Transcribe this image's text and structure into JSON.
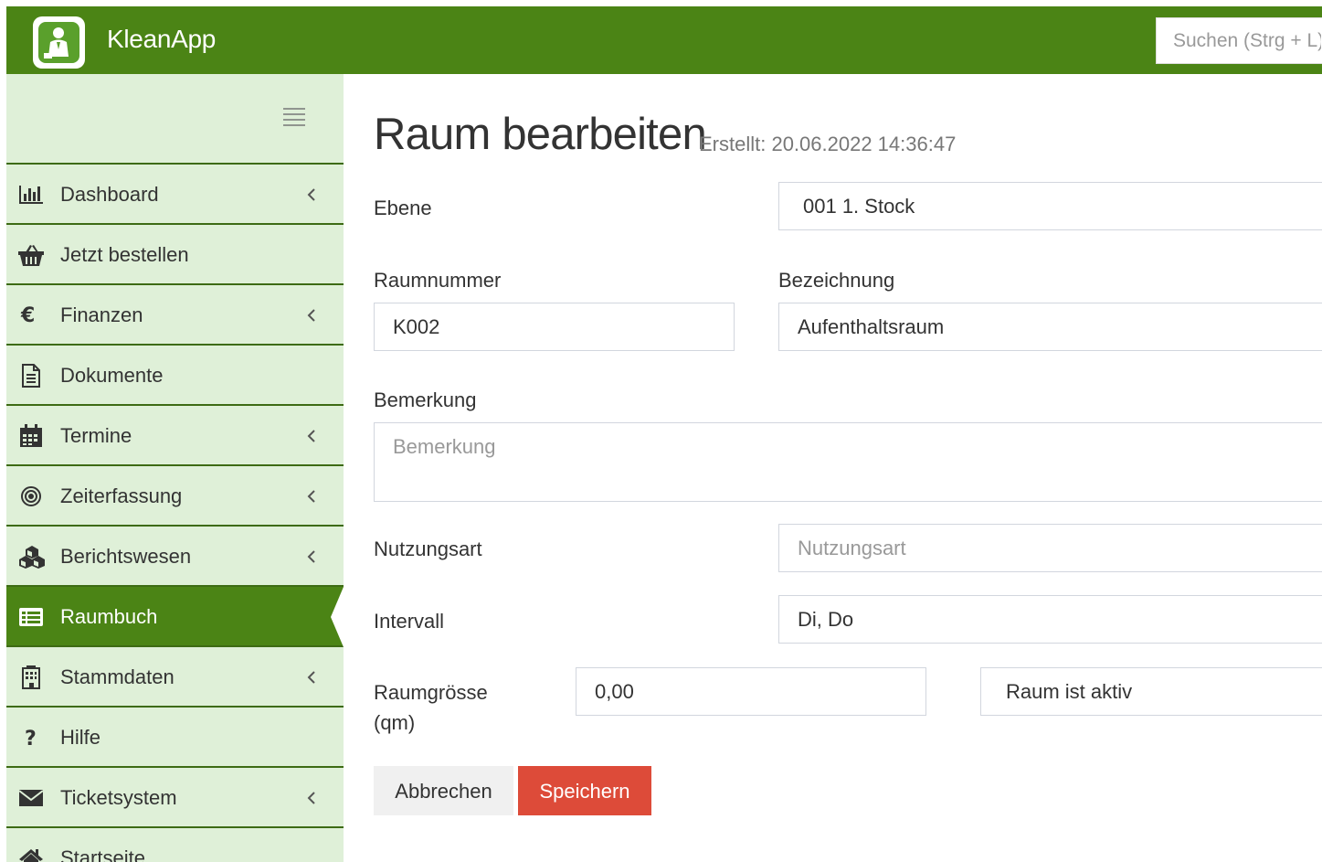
{
  "app": {
    "brand": "KleanApp",
    "search_placeholder": "Suchen (Strg + L)"
  },
  "sidebar": {
    "items": [
      {
        "label": "Dashboard",
        "icon": "bar-chart-icon",
        "has_submenu": true
      },
      {
        "label": "Jetzt bestellen",
        "icon": "basket-icon",
        "has_submenu": false
      },
      {
        "label": "Finanzen",
        "icon": "euro-icon",
        "has_submenu": true
      },
      {
        "label": "Dokumente",
        "icon": "document-icon",
        "has_submenu": false
      },
      {
        "label": "Termine",
        "icon": "calendar-icon",
        "has_submenu": true
      },
      {
        "label": "Zeiterfassung",
        "icon": "target-icon",
        "has_submenu": true
      },
      {
        "label": "Berichtswesen",
        "icon": "cubes-icon",
        "has_submenu": true
      },
      {
        "label": "Raumbuch",
        "icon": "list-alt-icon",
        "has_submenu": false,
        "active": true
      },
      {
        "label": "Stammdaten",
        "icon": "building-icon",
        "has_submenu": true
      },
      {
        "label": "Hilfe",
        "icon": "question-icon",
        "has_submenu": false
      },
      {
        "label": "Ticketsystem",
        "icon": "envelope-icon",
        "has_submenu": true
      },
      {
        "label": "Startseite",
        "icon": "home-icon",
        "has_submenu": false
      }
    ]
  },
  "page": {
    "title": "Raum bearbeiten",
    "subtitle": "Erstellt: 20.06.2022 14:36:47"
  },
  "form": {
    "ebene": {
      "label": "Ebene",
      "value": "001 1. Stock"
    },
    "raumnummer": {
      "label": "Raumnummer",
      "value": "K002"
    },
    "bezeichnung": {
      "label": "Bezeichnung",
      "value": "Aufenthaltsraum"
    },
    "bemerkung": {
      "label": "Bemerkung",
      "value": "",
      "placeholder": "Bemerkung"
    },
    "nutzungsart": {
      "label": "Nutzungsart",
      "value": "",
      "placeholder": "Nutzungsart"
    },
    "intervall": {
      "label": "Intervall",
      "value": "Di, Do"
    },
    "raumgroesse": {
      "label_line1": "Raumgrösse",
      "label_line2": "(qm)",
      "value": "0,00"
    },
    "aktiv": {
      "label": "Raum ist aktiv"
    }
  },
  "buttons": {
    "cancel": "Abbrechen",
    "save": "Speichern"
  },
  "colors": {
    "brand_green": "#4b8415",
    "sidebar_bg": "#dff0d8",
    "save_red": "#dd4b39"
  }
}
